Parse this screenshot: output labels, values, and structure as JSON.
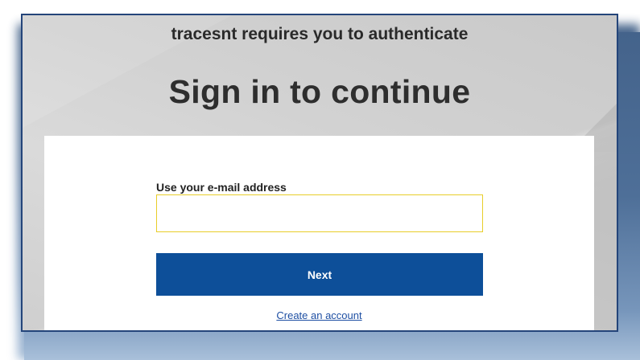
{
  "header": {
    "auth_note": "tracesnt requires you to authenticate",
    "title": "Sign in to continue"
  },
  "form": {
    "email_label": "Use your e-mail address",
    "email_value": "",
    "email_placeholder": "",
    "next_label": "Next",
    "create_account_label": "Create an account"
  },
  "colors": {
    "primary_button": "#0d4f99",
    "input_focus_border": "#e8cd2a",
    "link": "#1e4fa3",
    "window_border": "#24457a",
    "backdrop_shadow": "#4b6c95"
  }
}
